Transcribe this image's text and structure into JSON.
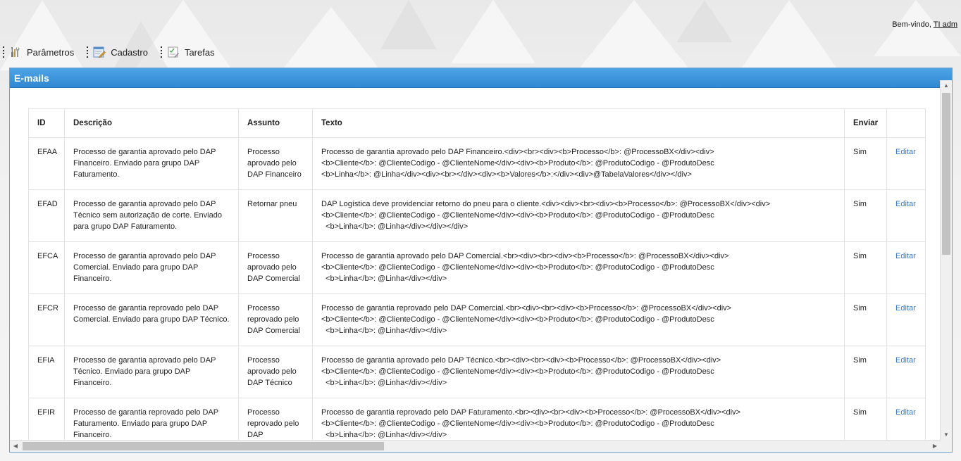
{
  "header": {
    "welcome_label": "Bem-vindo,",
    "user_name": "TI adm"
  },
  "menu": [
    {
      "label": "Parâmetros",
      "icon": "tools-icon"
    },
    {
      "label": "Cadastro",
      "icon": "form-edit-icon"
    },
    {
      "label": "Tarefas",
      "icon": "checklist-icon"
    }
  ],
  "panel": {
    "title": "E-mails"
  },
  "table": {
    "columns": [
      "ID",
      "Descrição",
      "Assunto",
      "Texto",
      "Enviar",
      ""
    ],
    "rows": [
      {
        "id": "EFAA",
        "descricao": "Processo de garantia aprovado pelo DAP Financeiro. Enviado para grupo DAP Faturamento.",
        "assunto": "Processo aprovado pelo DAP Financeiro",
        "texto": "Processo de garantia aprovado pelo DAP Financeiro.<div><br><div><b>Processo</b>: @ProcessoBX</div><div>\n<b>Cliente</b>: @ClienteCodigo - @ClienteNome</div><div><b>Produto</b>: @ProdutoCodigo - @ProdutoDesc\n<b>Linha</b>: @Linha</div><div><br></div><div><b>Valores</b>:</div><div>@TabelaValores</div></div>",
        "enviar": "Sim",
        "action": "Editar"
      },
      {
        "id": "EFAD",
        "descricao": "Processo de garantia aprovado pelo DAP Técnico sem autorização de corte. Enviado para grupo DAP Faturamento.",
        "assunto": "Retornar pneu",
        "texto": "DAP Logística deve providenciar retorno do pneu para o cliente.<div><div><br><div><b>Processo</b>: @ProcessoBX</div><div>\n<b>Cliente</b>: @ClienteCodigo - @ClienteNome</div><div><b>Produto</b>: @ProdutoCodigo - @ProdutoDesc\n  <b>Linha</b>: @Linha</div></div></div>",
        "enviar": "Sim",
        "action": "Editar"
      },
      {
        "id": "EFCA",
        "descricao": "Processo de garantia aprovado pelo DAP Comercial. Enviado para grupo DAP Financeiro.",
        "assunto": "Processo aprovado pelo DAP Comercial",
        "texto": "Processo de garantia aprovado pelo DAP Comercial.<br><div><br><div><b>Processo</b>: @ProcessoBX</div><div>\n<b>Cliente</b>: @ClienteCodigo - @ClienteNome</div><div><b>Produto</b>: @ProdutoCodigo - @ProdutoDesc\n  <b>Linha</b>: @Linha</div></div>",
        "enviar": "Sim",
        "action": "Editar"
      },
      {
        "id": "EFCR",
        "descricao": "Processo de garantia reprovado pelo DAP Comercial. Enviado para grupo DAP Técnico.",
        "assunto": "Processo reprovado pelo DAP Comercial",
        "texto": "Processo de garantia reprovado pelo DAP Comercial.<br><div><br><div><b>Processo</b>: @ProcessoBX</div><div>\n<b>Cliente</b>: @ClienteCodigo - @ClienteNome</div><div><b>Produto</b>: @ProdutoCodigo - @ProdutoDesc\n  <b>Linha</b>: @Linha</div></div>",
        "enviar": "Sim",
        "action": "Editar"
      },
      {
        "id": "EFIA",
        "descricao": "Processo de garantia aprovado pelo DAP Técnico. Enviado para grupo DAP Financeiro.",
        "assunto": "Processo aprovado pelo DAP Técnico",
        "texto": "Processo de garantia aprovado pelo DAP Técnico.<br><div><br><div><b>Processo</b>: @ProcessoBX</div><div>\n<b>Cliente</b>: @ClienteCodigo - @ClienteNome</div><div><b>Produto</b>: @ProdutoCodigo - @ProdutoDesc\n  <b>Linha</b>: @Linha</div></div>",
        "enviar": "Sim",
        "action": "Editar"
      },
      {
        "id": "EFIR",
        "descricao": "Processo de garantia reprovado pelo DAP Faturamento. Enviado para grupo DAP Financeiro.",
        "assunto": "Processo reprovado pelo DAP",
        "texto": "Processo de garantia reprovado pelo DAP Faturamento.<br><div><br><div><b>Processo</b>: @ProcessoBX</div><div>\n<b>Cliente</b>: @ClienteCodigo - @ClienteNome</div><div><b>Produto</b>: @ProdutoCodigo - @ProdutoDesc\n  <b>Linha</b>: @Linha</div></div>",
        "enviar": "Sim",
        "action": "Editar"
      }
    ]
  },
  "colors": {
    "panel_header": "#3a95dc",
    "link": "#2f7bd2"
  }
}
